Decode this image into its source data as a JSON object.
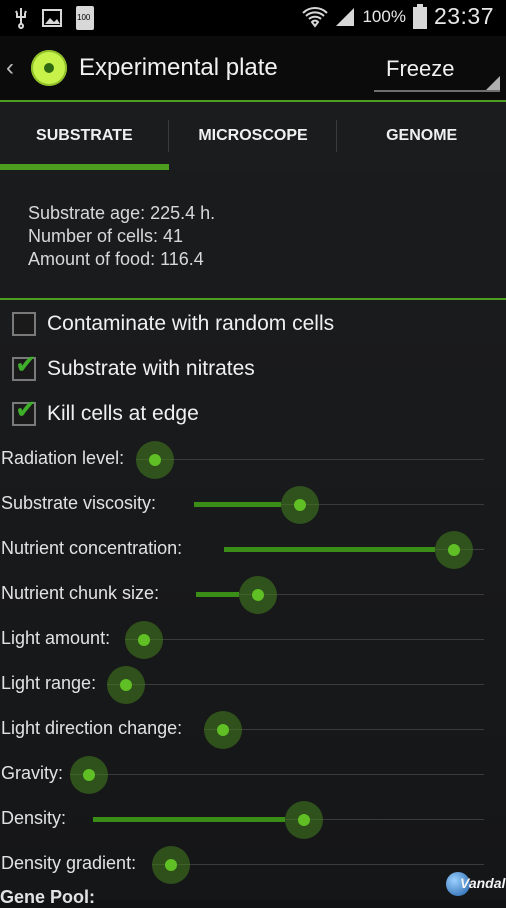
{
  "status_bar": {
    "battery_percent": "100%",
    "time": "23:37",
    "battery_icon_text": "100"
  },
  "action_bar": {
    "title": "Experimental plate",
    "spinner_value": "Freeze"
  },
  "tabs": [
    {
      "label": "SUBSTRATE",
      "selected": true
    },
    {
      "label": "MICROSCOPE",
      "selected": false
    },
    {
      "label": "GENOME",
      "selected": false
    }
  ],
  "stats": {
    "age": "Substrate age: 225.4 h.",
    "cells": "Number of cells: 41",
    "food": "Amount of food: 116.4"
  },
  "options": [
    {
      "label": "Contaminate with random cells",
      "checked": false
    },
    {
      "label": "Substrate with nitrates",
      "checked": true
    },
    {
      "label": "Kill cells at edge",
      "checked": true
    }
  ],
  "sliders": [
    {
      "label": "Radiation level:",
      "level": 0.0
    },
    {
      "label": "Substrate viscosity:",
      "level": 0.3
    },
    {
      "label": "Nutrient concentration:",
      "level": 0.81
    },
    {
      "label": "Nutrient chunk size:",
      "level": 0.15
    },
    {
      "label": "Light amount:",
      "level": 0.0
    },
    {
      "label": "Light range:",
      "level": 0.0
    },
    {
      "label": "Light direction change:",
      "level": 0.0
    },
    {
      "label": "Gravity:",
      "level": 0.0
    },
    {
      "label": "Density:",
      "level": 0.49
    },
    {
      "label": "Density gradient:",
      "level": 0.0
    }
  ],
  "section_partial": "Gene Pool:",
  "watermark": "Vandal",
  "colors": {
    "accent": "#4d9d1f",
    "background": "#151618",
    "checkmark": "#3fae2a"
  }
}
